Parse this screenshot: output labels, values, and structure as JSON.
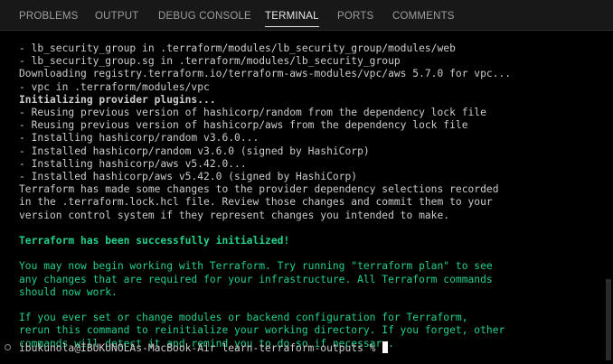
{
  "tabs": [
    {
      "label": "PROBLEMS",
      "active": false
    },
    {
      "label": "OUTPUT",
      "active": false
    },
    {
      "label": "DEBUG CONSOLE",
      "active": false
    },
    {
      "label": "TERMINAL",
      "active": true
    },
    {
      "label": "PORTS",
      "active": false
    },
    {
      "label": "COMMENTS",
      "active": false
    }
  ],
  "terminal": {
    "lines": [
      {
        "text": "- lb_security_group in .terraform/modules/lb_security_group/modules/web",
        "style": "normal"
      },
      {
        "text": "- lb_security_group.sg in .terraform/modules/lb_security_group",
        "style": "normal"
      },
      {
        "text": "Downloading registry.terraform.io/terraform-aws-modules/vpc/aws 5.7.0 for vpc...",
        "style": "normal"
      },
      {
        "text": "- vpc in .terraform/modules/vpc",
        "style": "normal"
      },
      {
        "text": "Initializing provider plugins...",
        "style": "bold"
      },
      {
        "text": "- Reusing previous version of hashicorp/random from the dependency lock file",
        "style": "normal"
      },
      {
        "text": "- Reusing previous version of hashicorp/aws from the dependency lock file",
        "style": "normal"
      },
      {
        "text": "- Installing hashicorp/random v3.6.0...",
        "style": "normal"
      },
      {
        "text": "- Installed hashicorp/random v3.6.0 (signed by HashiCorp)",
        "style": "normal"
      },
      {
        "text": "- Installing hashicorp/aws v5.42.0...",
        "style": "normal"
      },
      {
        "text": "- Installed hashicorp/aws v5.42.0 (signed by HashiCorp)",
        "style": "normal"
      },
      {
        "text": "Terraform has made some changes to the provider dependency selections recorded",
        "style": "normal"
      },
      {
        "text": "in the .terraform.lock.hcl file. Review those changes and commit them to your",
        "style": "normal"
      },
      {
        "text": "version control system if they represent changes you intended to make.",
        "style": "normal"
      },
      {
        "text": "",
        "style": "normal"
      },
      {
        "text": "Terraform has been successfully initialized!",
        "style": "green-bold"
      },
      {
        "text": "",
        "style": "normal"
      },
      {
        "text": "You may now begin working with Terraform. Try running \"terraform plan\" to see",
        "style": "green"
      },
      {
        "text": "any changes that are required for your infrastructure. All Terraform commands",
        "style": "green"
      },
      {
        "text": "should now work.",
        "style": "green"
      },
      {
        "text": "",
        "style": "normal"
      },
      {
        "text": "If you ever set or change modules or backend configuration for Terraform,",
        "style": "green"
      },
      {
        "text": "rerun this command to reinitialize your working directory. If you forget, other",
        "style": "green"
      },
      {
        "text": "commands will detect it and remind you to do so if necessary.",
        "style": "green"
      }
    ],
    "prompt": "ibukunola@IBUKUNOLAs-MacBook-Air learn-terraform-outputs % "
  },
  "colors": {
    "tab_bar_bg": "#181818",
    "tab_inactive": "#9d9d9d",
    "tab_active": "#e7e7e7",
    "terminal_bg": "#000000",
    "text_default": "#cccccc",
    "text_green": "#23d18b"
  },
  "icons": {
    "prompt_marker": "circle-outline-icon",
    "cursor": "block-cursor-icon"
  }
}
